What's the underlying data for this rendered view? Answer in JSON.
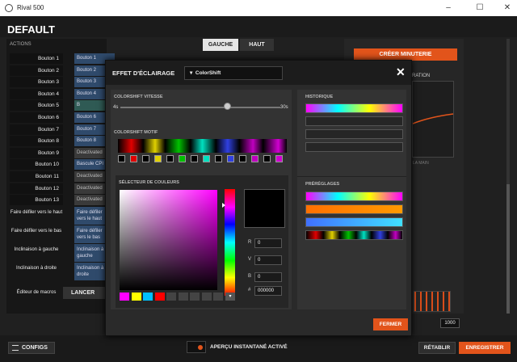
{
  "window": {
    "title": "Rival 500"
  },
  "app": {
    "profile_title": "DEFAULT"
  },
  "actions": {
    "label": "ACTIONS",
    "buttons": [
      {
        "label": "Bouton 1",
        "value": "Bouton 1"
      },
      {
        "label": "Bouton 2",
        "value": "Bouton 2"
      },
      {
        "label": "Bouton 3",
        "value": "Bouton 3"
      },
      {
        "label": "Bouton 4",
        "value": "Bouton 4"
      },
      {
        "label": "Bouton 5",
        "value": "B"
      },
      {
        "label": "Bouton 6",
        "value": "Bouton 6"
      },
      {
        "label": "Bouton 7",
        "value": "Bouton 7"
      },
      {
        "label": "Bouton 8",
        "value": "Bouton 8"
      },
      {
        "label": "Bouton 9",
        "value": "Deactivated"
      },
      {
        "label": "Bouton 10",
        "value": "Bascule CPI"
      },
      {
        "label": "Bouton 11",
        "value": "Deactivated"
      },
      {
        "label": "Bouton 12",
        "value": "Deactivated"
      },
      {
        "label": "Bouton 13",
        "value": "Deactivated"
      }
    ],
    "scroll_rows": [
      {
        "label": "Faire défiler vers le haut",
        "value": "Faire défiler vers le haut"
      },
      {
        "label": "Faire défiler vers le bas",
        "value": "Faire défiler vers le bas"
      },
      {
        "label": "Inclinaison à gauche",
        "value": "Inclinaison à gauche"
      },
      {
        "label": "Inclinaison à droite",
        "value": "Inclinaison à droite"
      }
    ],
    "macro_editor": "Éditeur de macros",
    "launch": "LANCER"
  },
  "view_tabs": {
    "left": "GAUCHE",
    "top": "HAUT"
  },
  "right_panel": {
    "create_timer": "CRÉER MINUTERIE",
    "ration_label": "RATION",
    "hand_label": "LA MAIN",
    "value": "1000"
  },
  "bottom": {
    "configs": "CONFIGS",
    "preview": "APERÇU INSTANTANÉ ACTIVÉ",
    "reset": "RÉTABLIR",
    "save": "ENREGISTRER"
  },
  "modal": {
    "title": "EFFET D'ÉCLAIRAGE",
    "mode": "ColorShift",
    "speed_label": "COLORSHIFT VITESSE",
    "speed_min": "4s",
    "speed_max": "30s",
    "pattern_label": "COLORSHIFT MOTIF",
    "picker_label": "SÉLECTEUR DE COULEURS",
    "rgb": {
      "r_label": "R",
      "r": "0",
      "v_label": "V",
      "v": "0",
      "b_label": "B",
      "b": "0",
      "hex_label": "#",
      "hex": "000000"
    },
    "history_label": "HISTORIQUE",
    "presets_label": "PRÉRÉGLAGES",
    "close_label": "FERMER"
  },
  "colors": {
    "accent": "#e2541b",
    "picker_hue": "#ff00ff",
    "pattern_stops": [
      "#000000",
      "#e00000",
      "#000000",
      "#e0d000",
      "#000000",
      "#00c000",
      "#000000",
      "#00e0c0",
      "#000000",
      "#3040e0",
      "#000000",
      "#c000c0",
      "#000000",
      "#d000d0"
    ],
    "swatches": [
      "#ff00ff",
      "#ffff00",
      "#00c0ff",
      "#ff0000",
      "#444444",
      "#444444",
      "#444444",
      "#444444",
      "#444444"
    ]
  }
}
